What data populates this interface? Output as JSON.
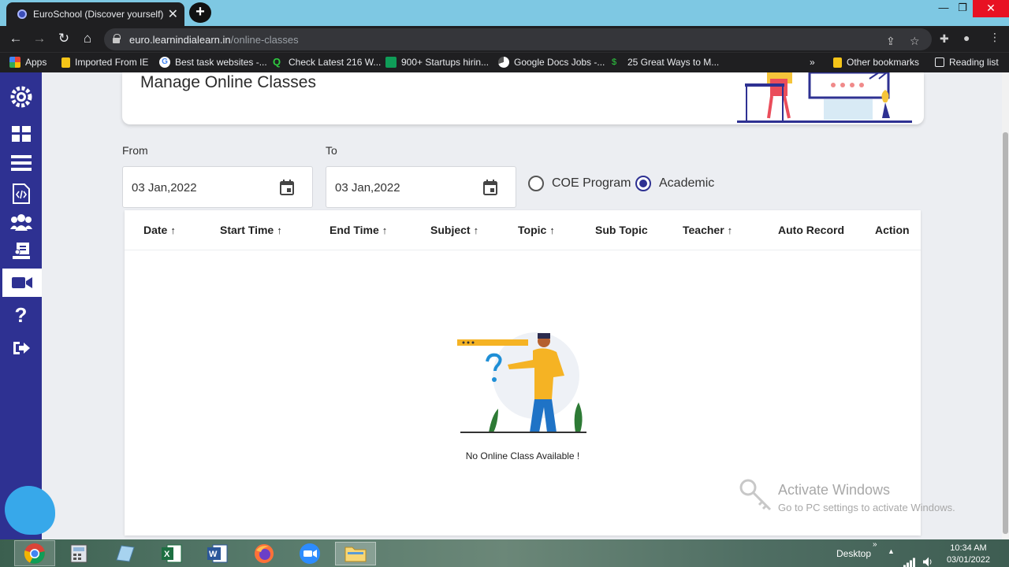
{
  "browser": {
    "tab_title": "EuroSchool (Discover yourself)",
    "tab_close": "✕",
    "new_tab": "+",
    "url_host": "euro.learnindialearn.in",
    "url_path": "/online-classes",
    "bookmarks": [
      {
        "label": "Apps",
        "icon": "apps-grid-icon"
      },
      {
        "label": "Imported From IE",
        "icon": "folder-icon"
      },
      {
        "label": "Best task websites -...",
        "icon": "google-icon"
      },
      {
        "label": "Check Latest 216 W...",
        "icon": "q-icon"
      },
      {
        "label": "900+ Startups hirin...",
        "icon": "sheets-icon"
      },
      {
        "label": "Google Docs Jobs -...",
        "icon": "docs-icon"
      },
      {
        "label": "25 Great Ways to M...",
        "icon": "money-icon"
      }
    ],
    "bookmarks_overflow": "»",
    "other_bookmarks": "Other bookmarks",
    "reading_list": "Reading list"
  },
  "page": {
    "title": "Manage Online Classes",
    "from_label": "From",
    "to_label": "To",
    "from_date": "03 Jan,2022",
    "to_date": "03 Jan,2022",
    "radio_options": [
      {
        "label": "COE Program",
        "checked": false
      },
      {
        "label": "Academic",
        "checked": true
      }
    ],
    "table": {
      "columns": [
        {
          "label": "Date",
          "sortable": true
        },
        {
          "label": "Start Time",
          "sortable": true
        },
        {
          "label": "End Time",
          "sortable": true
        },
        {
          "label": "Subject",
          "sortable": true
        },
        {
          "label": "Topic",
          "sortable": true
        },
        {
          "label": "Sub Topic",
          "sortable": false
        },
        {
          "label": "Teacher",
          "sortable": true
        },
        {
          "label": "Auto Record",
          "sortable": false
        },
        {
          "label": "Action",
          "sortable": false
        }
      ],
      "empty_message": "No Online Class Available !"
    }
  },
  "sidebar": {
    "items": [
      {
        "icon": "logo-gear-icon"
      },
      {
        "icon": "dashboard-grid-icon"
      },
      {
        "icon": "list-icon"
      },
      {
        "icon": "code-file-icon"
      },
      {
        "icon": "users-group-icon"
      },
      {
        "icon": "teacher-board-icon"
      },
      {
        "icon": "video-camera-icon",
        "active": true
      },
      {
        "icon": "help-icon"
      },
      {
        "icon": "logout-icon"
      }
    ]
  },
  "watermark": {
    "title": "Activate Windows",
    "subtitle": "Go to PC settings to activate Windows."
  },
  "taskbar": {
    "desktop_label": "Desktop",
    "time": "10:34 AM",
    "date": "03/01/2022",
    "apps": [
      "chrome",
      "calculator",
      "notes",
      "excel",
      "word",
      "firefox",
      "zoom",
      "file-explorer"
    ]
  },
  "colors": {
    "sidebar": "#2e3192",
    "accent": "#2e3192",
    "tab_bar": "#7ec8e3"
  }
}
